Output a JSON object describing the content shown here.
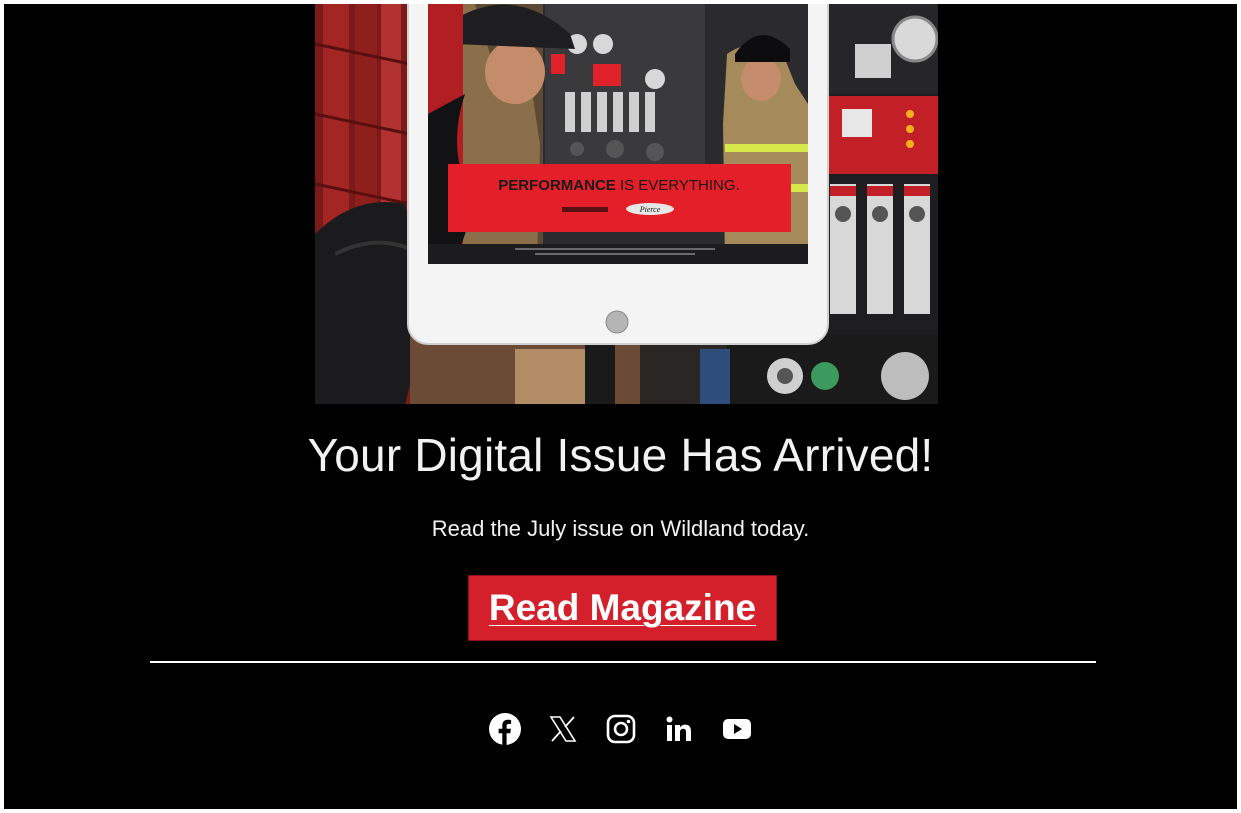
{
  "hero": {
    "ad_headline_bold": "PERFORMANCE",
    "ad_headline_rest": " IS EVERYTHING.",
    "ad_brand": "Pierce"
  },
  "headline": "Your Digital Issue Has Arrived!",
  "subhead": "Read the July issue on Wildland today.",
  "cta": {
    "label": "Read Magazine"
  },
  "social": {
    "icons": [
      "facebook-icon",
      "x-icon",
      "instagram-icon",
      "linkedin-icon",
      "youtube-icon"
    ],
    "color": "#ffffff"
  },
  "colors": {
    "background": "#000000",
    "cta_background": "#d4202a",
    "text": "#f2f2f2"
  }
}
